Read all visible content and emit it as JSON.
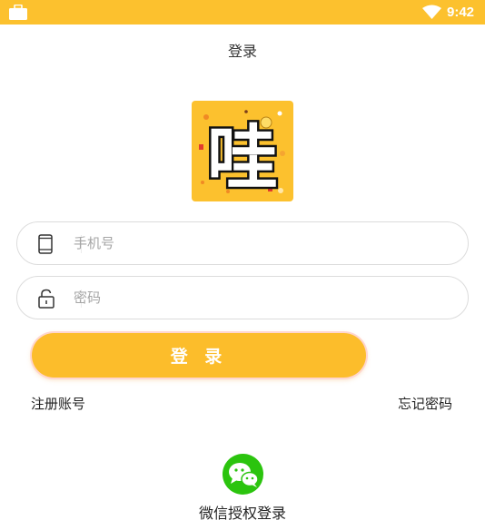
{
  "status_bar": {
    "time": "9:42",
    "icons": [
      "briefcase-icon",
      "wifi-icon"
    ]
  },
  "header": {
    "title": "登录"
  },
  "logo": {
    "char": "哇",
    "background": "#fcc12e"
  },
  "form": {
    "phone_placeholder": "手机号",
    "password_placeholder": "密码",
    "submit_label": "登 录"
  },
  "links": {
    "register": "注册账号",
    "forgot": "忘记密码"
  },
  "wechat": {
    "label": "微信授权登录",
    "color": "#2bc40e"
  },
  "colors": {
    "accent": "#fcc12e",
    "button": "#fcbd2b"
  }
}
